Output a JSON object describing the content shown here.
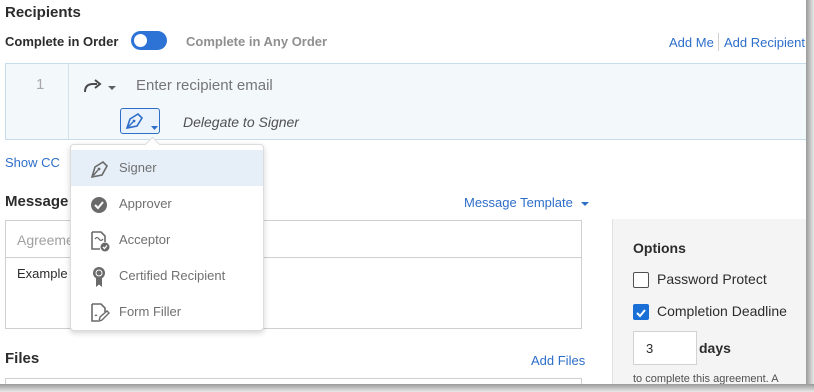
{
  "recipients": {
    "title": "Recipients",
    "complete_in_order": "Complete in Order",
    "complete_any_order": "Complete in Any Order",
    "add_me": "Add Me",
    "add_recipient": "Add Recipient",
    "row": {
      "number": "1",
      "email_placeholder": "Enter recipient email",
      "role_label": "Delegate to Signer"
    },
    "show_cc": "Show CC"
  },
  "role_menu": {
    "items": [
      {
        "label": "Signer",
        "icon": "pen-icon",
        "selected": true
      },
      {
        "label": "Approver",
        "icon": "check-circle-icon"
      },
      {
        "label": "Acceptor",
        "icon": "document-check-icon"
      },
      {
        "label": "Certified Recipient",
        "icon": "certificate-ribbon-icon"
      },
      {
        "label": "Form Filler",
        "icon": "form-edit-icon"
      }
    ]
  },
  "message": {
    "title": "Message",
    "template_link": "Message Template",
    "subject_value": "Agreeme",
    "body_value": "Example"
  },
  "files": {
    "title": "Files",
    "add_files": "Add Files"
  },
  "options": {
    "title": "Options",
    "password_protect": "Password Protect",
    "password_checked": false,
    "completion_deadline": "Completion Deadline",
    "deadline_checked": true,
    "days_value": "3",
    "days_label": "days",
    "deadline_note": "to complete this agreement. A"
  },
  "colors": {
    "accent": "#2d6ec9",
    "toggle": "#2d73d6",
    "checkbox": "#1a6fd6"
  }
}
